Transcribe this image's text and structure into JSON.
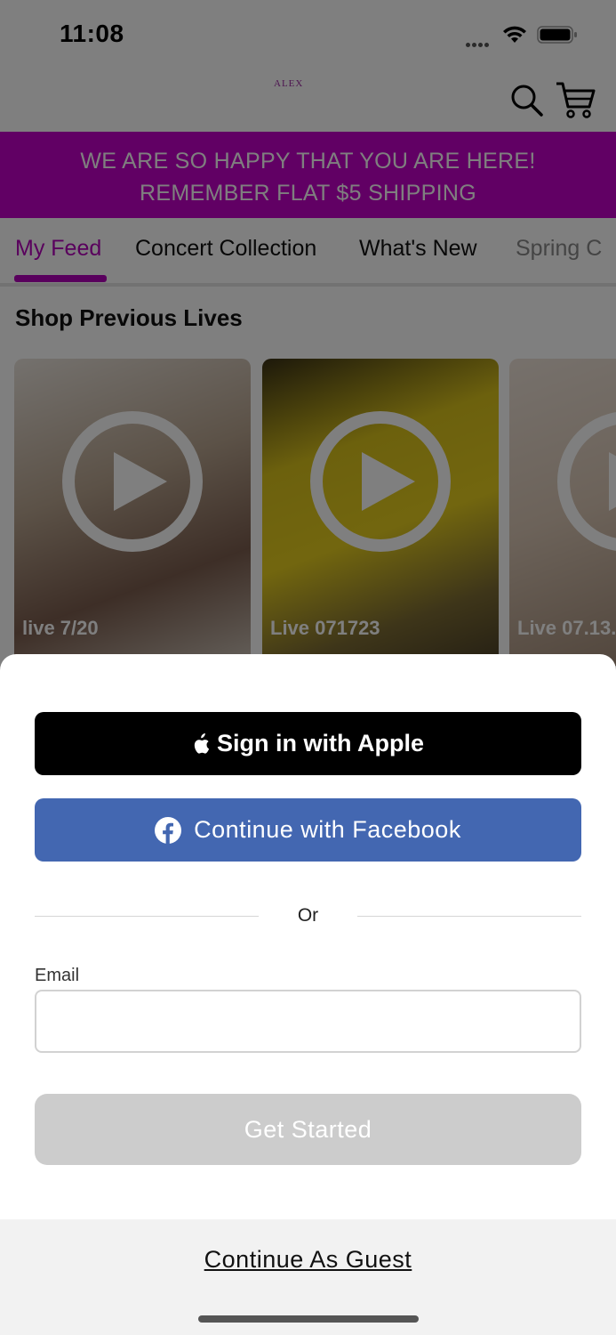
{
  "status_bar": {
    "time": "11:08"
  },
  "header": {
    "logo": "ALEX"
  },
  "banner": {
    "line1": "WE ARE SO HAPPY THAT YOU ARE HERE!",
    "line2": "REMEMBER FLAT $5 SHIPPING",
    "color": "#c200c8"
  },
  "tabs": [
    {
      "label": "My Feed",
      "active": true
    },
    {
      "label": "Concert Collection",
      "active": false
    },
    {
      "label": "What's New",
      "active": false
    },
    {
      "label": "Spring C",
      "active": false
    }
  ],
  "section": {
    "title": "Shop Previous Lives"
  },
  "cards": [
    {
      "label": "live 7/20"
    },
    {
      "label": "Live 071723"
    },
    {
      "label": "Live 07.13."
    }
  ],
  "sheet": {
    "apple_label": "Sign in with Apple",
    "facebook_label": "Continue with Facebook",
    "or_label": "Or",
    "email_label": "Email",
    "email_value": "",
    "get_started_label": "Get Started",
    "guest_label": "Continue As Guest"
  },
  "colors": {
    "accent": "#b300ba",
    "facebook": "#4367b1",
    "disabled_button": "#cccccc"
  },
  "icons": {
    "status": [
      "signal-icon",
      "wifi-icon",
      "battery-icon"
    ],
    "header": [
      "search-icon",
      "cart-icon"
    ],
    "card": "play-icon",
    "apple": "apple-icon",
    "facebook": "facebook-icon"
  }
}
